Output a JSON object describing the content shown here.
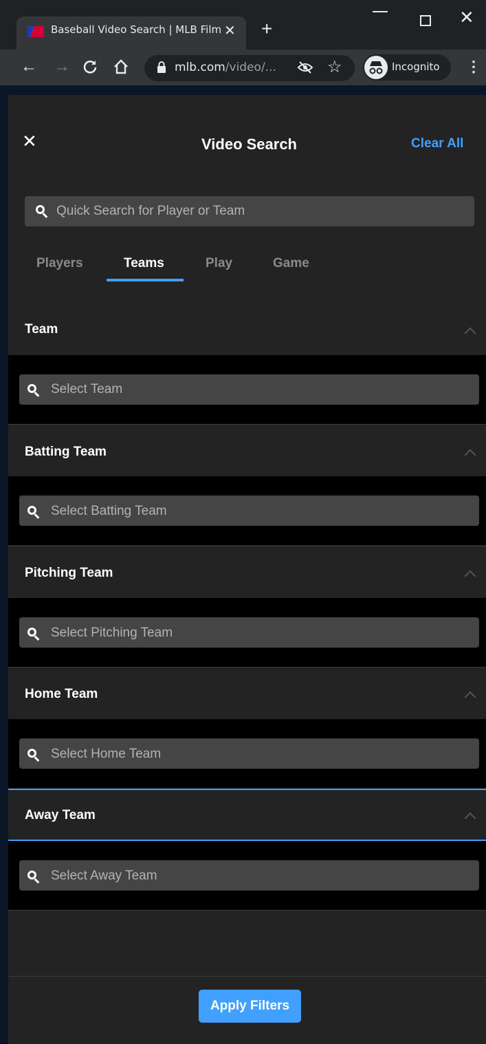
{
  "browser": {
    "tab_title": "Baseball Video Search | MLB Film",
    "url_domain": "mlb.com",
    "url_path": "/video/...",
    "incognito_label": "Incognito"
  },
  "panel": {
    "title": "Video Search",
    "clear_all": "Clear All",
    "quick_search_placeholder": "Quick Search for Player or Team",
    "tabs": [
      {
        "label": "Players",
        "active": false
      },
      {
        "label": "Teams",
        "active": true
      },
      {
        "label": "Play",
        "active": false
      },
      {
        "label": "Game",
        "active": false
      }
    ],
    "sections": [
      {
        "label": "Team",
        "input_placeholder": "Select Team"
      },
      {
        "label": "Batting Team",
        "input_placeholder": "Select Batting Team"
      },
      {
        "label": "Pitching Team",
        "input_placeholder": "Select Pitching Team"
      },
      {
        "label": "Home Team",
        "input_placeholder": "Select Home Team"
      },
      {
        "label": "Away Team",
        "input_placeholder": "Select Away Team"
      }
    ],
    "apply_label": "Apply Filters"
  },
  "colors": {
    "accent": "#41a0ff",
    "panel": "#232323",
    "input": "#454545"
  }
}
